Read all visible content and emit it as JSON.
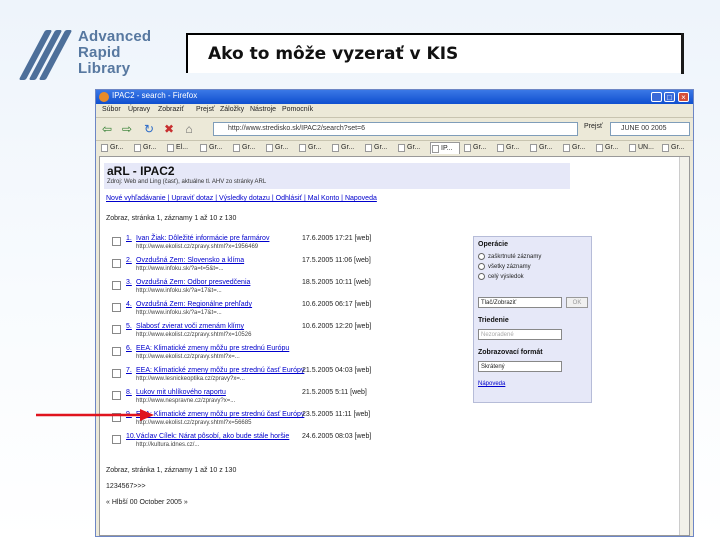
{
  "logo": {
    "line1": "Advanced",
    "line2": "Rapid",
    "line3": "Library"
  },
  "slide_title": "Ako to môže vyzerať v KIS",
  "browser": {
    "window_title": "IPAC2 - search - Firefox",
    "menu": [
      "Súbor",
      "Úpravy",
      "Zobraziť",
      "Prejsť",
      "Záložky",
      "Nástroje",
      "Pomocník"
    ],
    "url": "http://www.stredisko.sk/IPAC2/search?set=6",
    "go_label": "Prejsť",
    "search_value": "JUNE 00 2005",
    "tabs": [
      "Gr...",
      "Gr...",
      "El...",
      "Gr...",
      "Gr...",
      "Gr...",
      "Gr...",
      "Gr...",
      "Gr...",
      "Gr...",
      "IP...",
      "Gr...",
      "Gr...",
      "Gr...",
      "Gr...",
      "Gr...",
      "UN...",
      "Gr..."
    ],
    "active_tab": 10
  },
  "page": {
    "heading": "aRL - IPAC2",
    "subheading": "Zdroj: Web and Ling (časť), aktuálne tl. AHV zo stránky ARL",
    "nav_links": "Nové vyhľadávanie | Upraviť dotaz | Výsledky dotazu | Odhlásiť | Mal Konto | Napoveda",
    "status_top": "Zobraz, stránka 1, záznamy 1 až 10 z 130",
    "results": [
      {
        "num": "1.",
        "title": "Ivan Žiak: Dôležité informácie pre farmárov",
        "meta": "17.6.2005 17:21 [web]",
        "url": "http://www.ekolist.cz/zpravy.shtml?x=1956469"
      },
      {
        "num": "2.",
        "title": "Ovzdušná Zem: Slovensko a klíma",
        "meta": "17.5.2005 11:06 [web]",
        "url": "http://www.infoku.sk/?a=t=5&t=..."
      },
      {
        "num": "3.",
        "title": "Ovzdušná Zem: Odbor presvedčenia",
        "meta": "18.5.2005 10:11 [web]",
        "url": "http://www.infoku.sk/?a=17&t=..."
      },
      {
        "num": "4.",
        "title": "Ovzdušná Zem: Regionálne prehľady",
        "meta": "10.6.2005 06:17 [web]",
        "url": "http://www.infoku.sk/?a=17&t=..."
      },
      {
        "num": "5.",
        "title": "Slabosť zvierat voči zmenám klímy",
        "meta": "10.6.2005 12:20 [web]",
        "url": "http://www.ekolist.cz/zpravy.shtml?x=10526"
      },
      {
        "num": "6.",
        "title": "EEA: Klimatické zmeny môžu pre strednú Európu",
        "meta": "",
        "url": "http://www.ekolist.cz/zpravy.shtml?x=..."
      },
      {
        "num": "7.",
        "title": "EEA: Klimatické zmeny môžu pre strednú časť Európy",
        "meta": "21.5.2005 04:03 [web]",
        "url": "http://www.lesnickeoptika.cz/zpravy?x=..."
      },
      {
        "num": "8.",
        "title": "Lukov mit uhlíkového raportu",
        "meta": "21.5.2005 5:11 [web]",
        "url": "http://www.nespravne.cz/zpravy?x=..."
      },
      {
        "num": "9.",
        "title": "EEA: Klimatické zmeny môžu pre strednú časť Európy",
        "meta": "23.5.2005 11:11 [web]",
        "url": "http://www.ekolist.cz/zpravy.shtml?x=56685"
      },
      {
        "num": "10.",
        "title": "Václav Cílek: Nárat pôsobí, ako bude stále horšie",
        "meta": "24.6.2005 08:03 [web]",
        "url": "http://kultura.idnes.cz/..."
      }
    ],
    "status_bottom": "Zobraz, stránka 1, záznamy 1 až 10 z 130",
    "pager": [
      "1",
      "2",
      "3",
      "4",
      "5",
      "6",
      "7",
      ">",
      ">>"
    ],
    "footer": "« Hlbší 00 October 2005 »"
  },
  "panel": {
    "operations_label": "Operácie",
    "op1": "zaškrtnuté záznamy",
    "op2": "všetky záznamy",
    "op3": "celý výsledok",
    "action_select": "Tlač/Zobraziť",
    "ok_label": "OK",
    "sort_label": "Triedenie",
    "sort_select": "Nezoradené",
    "format_label": "Zobrazovací formát",
    "format_select": "Skrátený",
    "help_link": "Nápoveda"
  },
  "colors": {
    "arrow": "#e0141e",
    "accent": "#0f4fcf",
    "link": "#0000cc"
  }
}
